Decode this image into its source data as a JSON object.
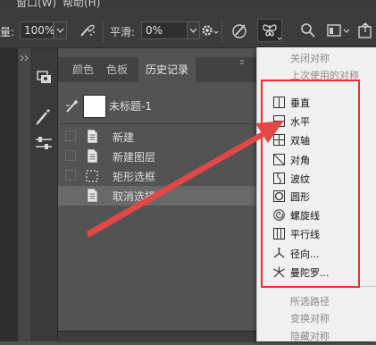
{
  "menubar": {
    "window_menu": "窗口(W)",
    "help_menu": "帮助(H)"
  },
  "options_bar": {
    "flow_label": "量:",
    "flow_value": "100%",
    "smoothing_label": "平滑:",
    "smoothing_value": "0%"
  },
  "panel": {
    "tabs": [
      {
        "label": "颜色",
        "active": false
      },
      {
        "label": "色板",
        "active": false
      },
      {
        "label": "历史记录",
        "active": true
      }
    ],
    "snapshot_label": "未标题-1",
    "history": [
      {
        "label": "新建",
        "icon": "document-icon",
        "selected": false
      },
      {
        "label": "新建图层",
        "icon": "document-icon",
        "selected": false
      },
      {
        "label": "矩形选框",
        "icon": "marquee-icon",
        "selected": false
      },
      {
        "label": "取消选择",
        "icon": "document-icon",
        "selected": true
      }
    ]
  },
  "symmetry_menu": {
    "top_items": [
      {
        "label": "关闭对称",
        "enabled": false
      },
      {
        "label": "上次使用的对称",
        "enabled": false
      }
    ],
    "items": [
      {
        "label": "垂直",
        "icon": "vertical-icon"
      },
      {
        "label": "水平",
        "icon": "horizontal-icon"
      },
      {
        "label": "双轴",
        "icon": "dual-axis-icon"
      },
      {
        "label": "对角",
        "icon": "diagonal-icon"
      },
      {
        "label": "波纹",
        "icon": "wavy-icon"
      },
      {
        "label": "圆形",
        "icon": "circle-icon"
      },
      {
        "label": "螺旋线",
        "icon": "spiral-icon"
      },
      {
        "label": "平行线",
        "icon": "parallel-lines-icon"
      },
      {
        "label": "径向...",
        "icon": "radial-icon"
      },
      {
        "label": "曼陀罗...",
        "icon": "mandala-icon"
      }
    ],
    "bottom_items": [
      {
        "label": "所选路径",
        "enabled": false
      },
      {
        "label": "变换对称",
        "enabled": false
      },
      {
        "label": "隐藏对称",
        "enabled": false
      }
    ]
  },
  "annotation": {
    "highlight_color": "#ea3030",
    "arrow_color": "#e24848"
  }
}
